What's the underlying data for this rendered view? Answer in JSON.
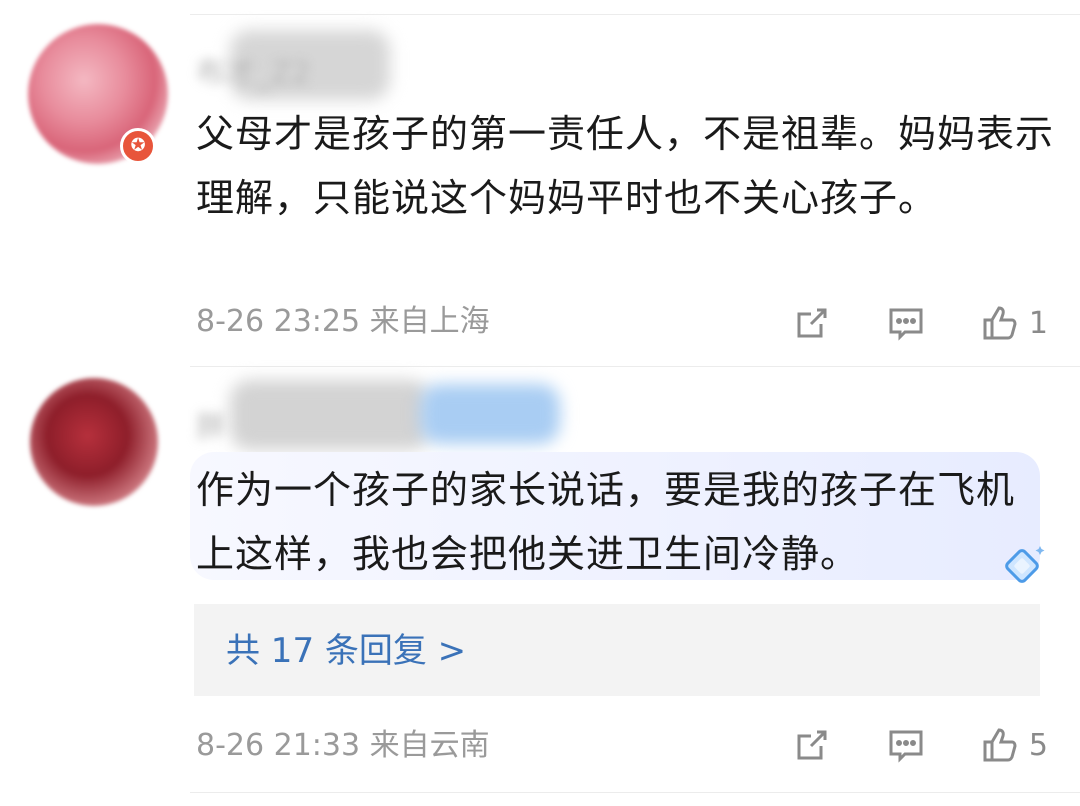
{
  "comments": [
    {
      "username": "布才_Z2",
      "text": "父母才是孩子的第一责任人，不是祖辈。妈妈表示理解，只能说这个妈妈平时也不关心孩子。",
      "date": "8-26 23:25",
      "location": "来自上海",
      "likes": "1",
      "icons": [
        "share-icon",
        "comment-icon",
        "like-icon"
      ]
    },
    {
      "username": "胖",
      "text": "作为一个孩子的家长说话，要是我的孩子在飞机上这样，我也会把他关进卫生间冷静。",
      "replies_label": "共 17 条回复 >",
      "date": "8-26 21:33",
      "location": "来自云南",
      "likes": "5",
      "icons": [
        "share-icon",
        "comment-icon",
        "like-icon"
      ]
    }
  ],
  "colors": {
    "link": "#3a72b8",
    "meta": "#9a9a9a",
    "badge": "#e8553b"
  }
}
